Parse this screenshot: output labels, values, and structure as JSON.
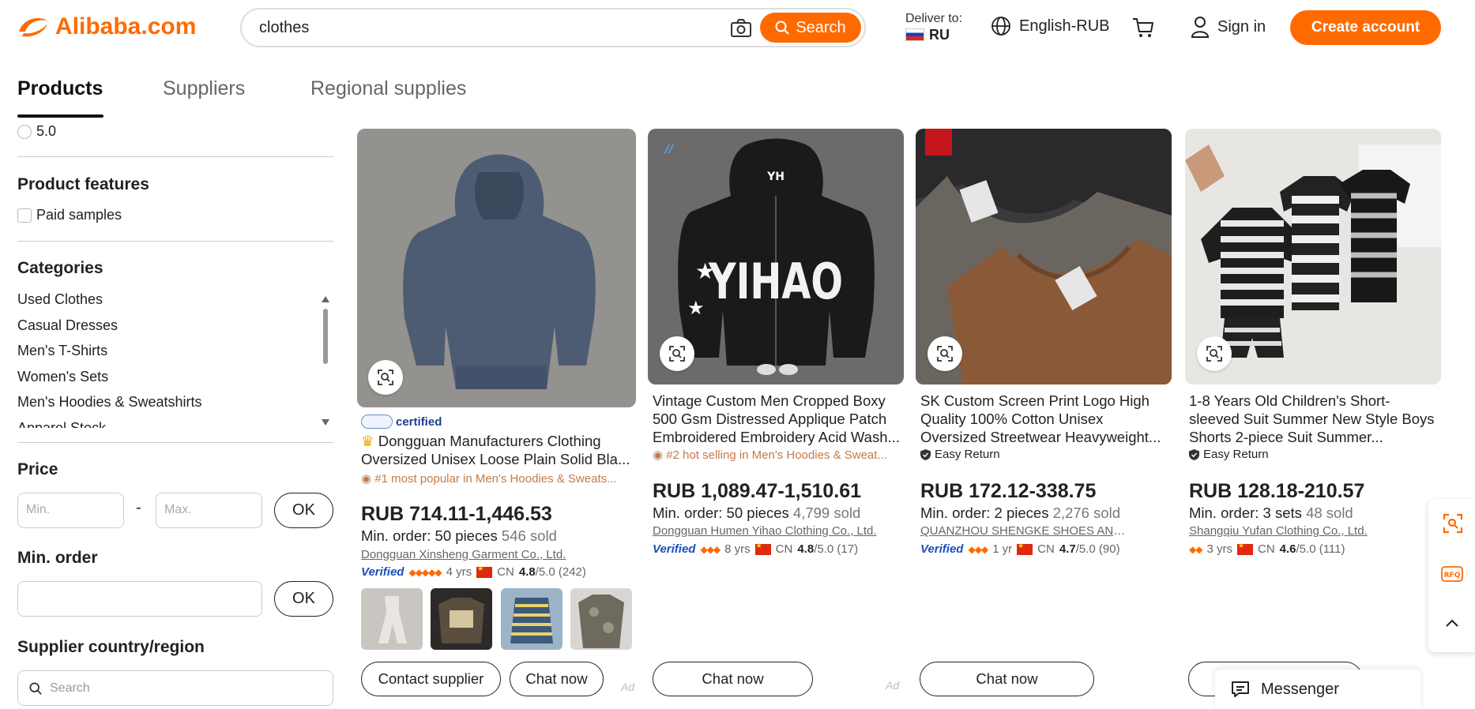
{
  "header": {
    "logo_text": "Alibaba.com",
    "search_value": "clothes",
    "search_button": "Search",
    "deliver_label": "Deliver to:",
    "deliver_country": "RU",
    "language": "English-RUB",
    "sign_in": "Sign in",
    "create_account": "Create account"
  },
  "tabs": [
    {
      "label": "Products",
      "active": true
    },
    {
      "label": "Suppliers",
      "active": false
    },
    {
      "label": "Regional supplies",
      "active": false
    }
  ],
  "filters": {
    "rating_option": "5.0",
    "features_heading": "Product features",
    "paid_samples": "Paid samples",
    "categories_heading": "Categories",
    "categories": [
      "Used Clothes",
      "Casual Dresses",
      "Men's T-Shirts",
      "Women's Sets",
      "Men's Hoodies & Sweatshirts",
      "Apparel Stock"
    ],
    "price_heading": "Price",
    "price_min_placeholder": "Min.",
    "price_sep": "-",
    "price_max_placeholder": "Max.",
    "ok": "OK",
    "min_order_heading": "Min. order",
    "supplier_country_heading": "Supplier country/region",
    "supplier_search_placeholder": "Search"
  },
  "products": [
    {
      "certified": "certified",
      "title": "Dongguan Manufacturers Clothing Oversized Unisex Loose Plain Solid Bla...",
      "badge": "#1 most popular in Men's Hoodies & Sweats...",
      "price": "RUB 714.11-1,446.53",
      "min_order": "Min. order: 50 pieces",
      "sold": "546 sold",
      "supplier": "Dongguan Xinsheng Garment Co., Ltd.",
      "verified": "Verified",
      "years": "4 yrs",
      "country": "CN",
      "rating": "4.8",
      "rating_suffix": "/5.0 (242)",
      "buttons": [
        "Contact supplier",
        "Chat now"
      ],
      "ad": "Ad"
    },
    {
      "title": "Vintage Custom Men Cropped Boxy 500 Gsm Distressed Applique Patch Embroidered Embroidery Acid Wash...",
      "badge": "#2 hot selling in Men's Hoodies & Sweat...",
      "price": "RUB 1,089.47-1,510.61",
      "min_order": "Min. order: 50 pieces",
      "sold": "4,799 sold",
      "supplier": "Dongguan Humen Yihao Clothing Co., Ltd.",
      "verified": "Verified",
      "years": "8 yrs",
      "country": "CN",
      "rating": "4.8",
      "rating_suffix": "/5.0 (17)",
      "buttons": [
        "Chat now"
      ],
      "ad": "Ad"
    },
    {
      "title": "SK Custom Screen Print Logo High Quality 100% Cotton Unisex Oversized Streetwear Heavyweight...",
      "badge": "Easy Return",
      "price": "RUB 172.12-338.75",
      "min_order": "Min. order: 2 pieces",
      "sold": "2,276 sold",
      "supplier": "QUANZHOU SHENGKE SHOES AND...",
      "verified": "Verified",
      "years": "1 yr",
      "country": "CN",
      "rating": "4.7",
      "rating_suffix": "/5.0 (90)",
      "buttons": [
        "Chat now"
      ]
    },
    {
      "title": "1-8 Years Old Children's Short-sleeved Suit Summer New Style Boys Shorts 2-piece Suit Summer...",
      "badge": "Easy Return",
      "price": "RUB 128.18-210.57",
      "min_order": "Min. order: 3 sets",
      "sold": "48 sold",
      "supplier": "Shangqiu Yufan Clothing Co., Ltd.",
      "years": "3 yrs",
      "country": "CN",
      "rating": "4.6",
      "rating_suffix": "/5.0 (111)"
    }
  ],
  "messenger": "Messenger",
  "colors": {
    "brand": "#ff6a00",
    "verified": "#1c4fb8"
  },
  "icons": [
    "alibaba-logo-icon",
    "camera-icon",
    "search-icon",
    "globe-icon",
    "cart-icon",
    "user-icon",
    "image-search-icon",
    "crown-icon",
    "fire-icon",
    "shield-check-icon",
    "message-icon",
    "scan-icon",
    "rfq-icon",
    "chevron-up-icon"
  ]
}
